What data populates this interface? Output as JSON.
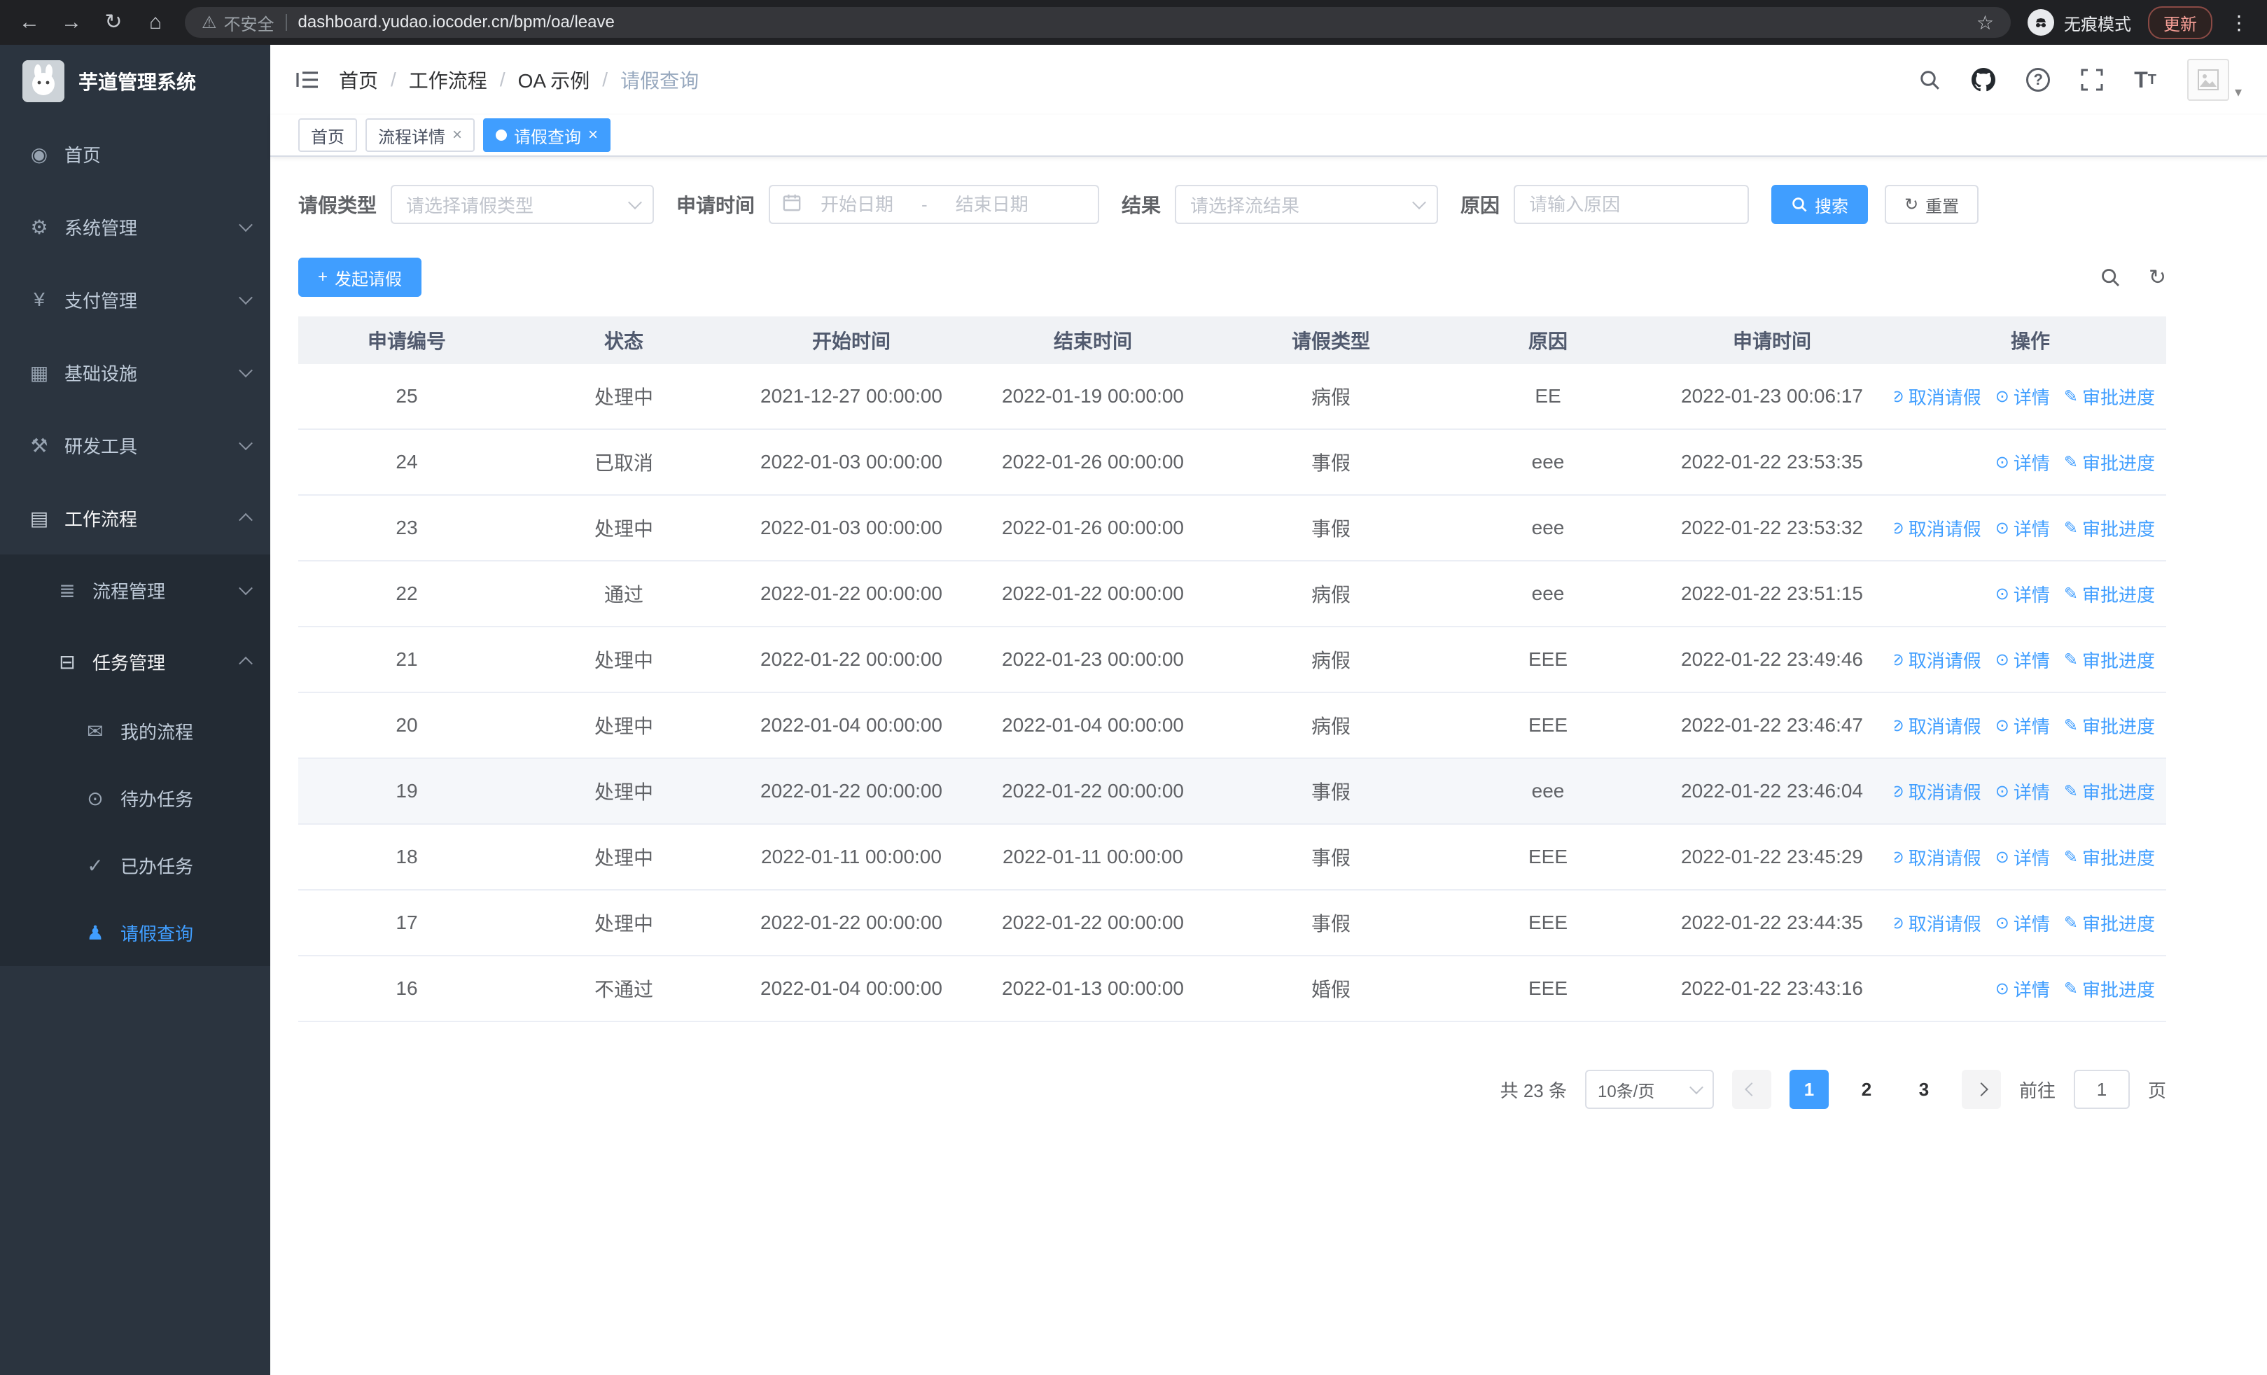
{
  "theme": {
    "primary": "#409eff",
    "sidebar_bg": "#2b343f",
    "sidebar_sub_bg": "#232b34",
    "chrome_bg": "#202124",
    "table_header_bg": "#f0f2f5"
  },
  "browser": {
    "warning": "不安全",
    "url": "dashboard.yudao.iocoder.cn/bpm/oa/leave",
    "incognito": "无痕模式",
    "update": "更新"
  },
  "sidebar": {
    "title": "芋道管理系统",
    "home": "首页",
    "system": "系统管理",
    "pay": "支付管理",
    "infra": "基础设施",
    "devtools": "研发工具",
    "workflow": "工作流程",
    "process_mgmt": "流程管理",
    "task_mgmt": "任务管理",
    "my_process": "我的流程",
    "todo_tasks": "待办任务",
    "done_tasks": "已办任务",
    "leave_query": "请假查询"
  },
  "header": {
    "breadcrumb": [
      "首页",
      "工作流程",
      "OA 示例",
      "请假查询"
    ]
  },
  "tabs": [
    {
      "label": "首页"
    },
    {
      "label": "流程详情"
    },
    {
      "label": "请假查询"
    }
  ],
  "filters": {
    "leave_type_label": "请假类型",
    "leave_type_placeholder": "请选择请假类型",
    "apply_time_label": "申请时间",
    "start_date_placeholder": "开始日期",
    "range_separator": "-",
    "end_date_placeholder": "结束日期",
    "result_label": "结果",
    "result_placeholder": "请选择流结果",
    "reason_label": "原因",
    "reason_placeholder": "请输入原因",
    "search_label": "搜索",
    "reset_label": "重置"
  },
  "toolbar": {
    "create_label": "发起请假"
  },
  "table": {
    "columns": [
      "申请编号",
      "状态",
      "开始时间",
      "结束时间",
      "请假类型",
      "原因",
      "申请时间",
      "操作"
    ],
    "actions_meta": {
      "cancel": {
        "label": "取消请假",
        "icon": "⊘",
        "icon_name": "cancel-leave-icon"
      },
      "detail": {
        "label": "详情",
        "icon": "⊙",
        "icon_name": "eye-icon"
      },
      "progress": {
        "label": "审批进度",
        "icon": "✎",
        "icon_name": "edit-icon"
      }
    },
    "rows": [
      {
        "id": "25",
        "status": "处理中",
        "start_time": "2021-12-27 00:00:00",
        "end_time": "2022-01-19 00:00:00",
        "leave_type": "病假",
        "reason": "EE",
        "apply_time": "2022-01-23 00:06:17",
        "actions": [
          "cancel",
          "detail",
          "progress"
        ]
      },
      {
        "id": "24",
        "status": "已取消",
        "start_time": "2022-01-03 00:00:00",
        "end_time": "2022-01-26 00:00:00",
        "leave_type": "事假",
        "reason": "eee",
        "apply_time": "2022-01-22 23:53:35",
        "actions": [
          "detail",
          "progress"
        ]
      },
      {
        "id": "23",
        "status": "处理中",
        "start_time": "2022-01-03 00:00:00",
        "end_time": "2022-01-26 00:00:00",
        "leave_type": "事假",
        "reason": "eee",
        "apply_time": "2022-01-22 23:53:32",
        "actions": [
          "cancel",
          "detail",
          "progress"
        ]
      },
      {
        "id": "22",
        "status": "通过",
        "start_time": "2022-01-22 00:00:00",
        "end_time": "2022-01-22 00:00:00",
        "leave_type": "病假",
        "reason": "eee",
        "apply_time": "2022-01-22 23:51:15",
        "actions": [
          "detail",
          "progress"
        ]
      },
      {
        "id": "21",
        "status": "处理中",
        "start_time": "2022-01-22 00:00:00",
        "end_time": "2022-01-23 00:00:00",
        "leave_type": "病假",
        "reason": "EEE",
        "apply_time": "2022-01-22 23:49:46",
        "actions": [
          "cancel",
          "detail",
          "progress"
        ]
      },
      {
        "id": "20",
        "status": "处理中",
        "start_time": "2022-01-04 00:00:00",
        "end_time": "2022-01-04 00:00:00",
        "leave_type": "病假",
        "reason": "EEE",
        "apply_time": "2022-01-22 23:46:47",
        "actions": [
          "cancel",
          "detail",
          "progress"
        ]
      },
      {
        "id": "19",
        "status": "处理中",
        "start_time": "2022-01-22 00:00:00",
        "end_time": "2022-01-22 00:00:00",
        "leave_type": "事假",
        "reason": "eee",
        "apply_time": "2022-01-22 23:46:04",
        "actions": [
          "cancel",
          "detail",
          "progress"
        ]
      },
      {
        "id": "18",
        "status": "处理中",
        "start_time": "2022-01-11 00:00:00",
        "end_time": "2022-01-11 00:00:00",
        "leave_type": "事假",
        "reason": "EEE",
        "apply_time": "2022-01-22 23:45:29",
        "actions": [
          "cancel",
          "detail",
          "progress"
        ]
      },
      {
        "id": "17",
        "status": "处理中",
        "start_time": "2022-01-22 00:00:00",
        "end_time": "2022-01-22 00:00:00",
        "leave_type": "事假",
        "reason": "EEE",
        "apply_time": "2022-01-22 23:44:35",
        "actions": [
          "cancel",
          "detail",
          "progress"
        ]
      },
      {
        "id": "16",
        "status": "不通过",
        "start_time": "2022-01-04 00:00:00",
        "end_time": "2022-01-13 00:00:00",
        "leave_type": "婚假",
        "reason": "EEE",
        "apply_time": "2022-01-22 23:43:16",
        "actions": [
          "detail",
          "progress"
        ]
      }
    ]
  },
  "pagination": {
    "total": "共 23 条",
    "page_size": "10条/页",
    "pages": [
      "1",
      "2",
      "3"
    ],
    "active_page": "1",
    "goto_label": "前往",
    "goto_value": "1",
    "unit_label": "页"
  }
}
